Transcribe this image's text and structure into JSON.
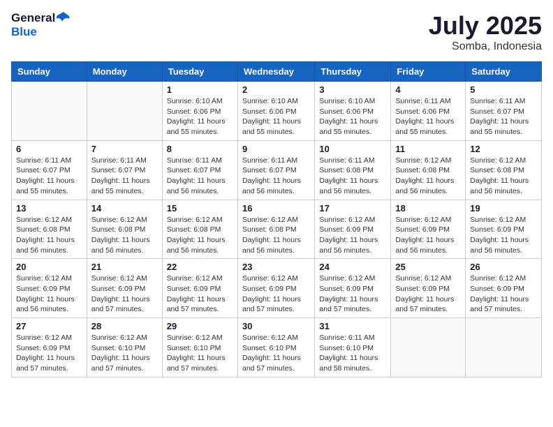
{
  "header": {
    "logo_general": "General",
    "logo_blue": "Blue",
    "title": "July 2025",
    "location": "Somba, Indonesia"
  },
  "calendar": {
    "days_of_week": [
      "Sunday",
      "Monday",
      "Tuesday",
      "Wednesday",
      "Thursday",
      "Friday",
      "Saturday"
    ],
    "weeks": [
      [
        {
          "day": "",
          "info": ""
        },
        {
          "day": "",
          "info": ""
        },
        {
          "day": "1",
          "info": "Sunrise: 6:10 AM\nSunset: 6:06 PM\nDaylight: 11 hours and 55 minutes."
        },
        {
          "day": "2",
          "info": "Sunrise: 6:10 AM\nSunset: 6:06 PM\nDaylight: 11 hours and 55 minutes."
        },
        {
          "day": "3",
          "info": "Sunrise: 6:10 AM\nSunset: 6:06 PM\nDaylight: 11 hours and 55 minutes."
        },
        {
          "day": "4",
          "info": "Sunrise: 6:11 AM\nSunset: 6:06 PM\nDaylight: 11 hours and 55 minutes."
        },
        {
          "day": "5",
          "info": "Sunrise: 6:11 AM\nSunset: 6:07 PM\nDaylight: 11 hours and 55 minutes."
        }
      ],
      [
        {
          "day": "6",
          "info": "Sunrise: 6:11 AM\nSunset: 6:07 PM\nDaylight: 11 hours and 55 minutes."
        },
        {
          "day": "7",
          "info": "Sunrise: 6:11 AM\nSunset: 6:07 PM\nDaylight: 11 hours and 55 minutes."
        },
        {
          "day": "8",
          "info": "Sunrise: 6:11 AM\nSunset: 6:07 PM\nDaylight: 11 hours and 56 minutes."
        },
        {
          "day": "9",
          "info": "Sunrise: 6:11 AM\nSunset: 6:07 PM\nDaylight: 11 hours and 56 minutes."
        },
        {
          "day": "10",
          "info": "Sunrise: 6:11 AM\nSunset: 6:08 PM\nDaylight: 11 hours and 56 minutes."
        },
        {
          "day": "11",
          "info": "Sunrise: 6:12 AM\nSunset: 6:08 PM\nDaylight: 11 hours and 56 minutes."
        },
        {
          "day": "12",
          "info": "Sunrise: 6:12 AM\nSunset: 6:08 PM\nDaylight: 11 hours and 56 minutes."
        }
      ],
      [
        {
          "day": "13",
          "info": "Sunrise: 6:12 AM\nSunset: 6:08 PM\nDaylight: 11 hours and 56 minutes."
        },
        {
          "day": "14",
          "info": "Sunrise: 6:12 AM\nSunset: 6:08 PM\nDaylight: 11 hours and 56 minutes."
        },
        {
          "day": "15",
          "info": "Sunrise: 6:12 AM\nSunset: 6:08 PM\nDaylight: 11 hours and 56 minutes."
        },
        {
          "day": "16",
          "info": "Sunrise: 6:12 AM\nSunset: 6:08 PM\nDaylight: 11 hours and 56 minutes."
        },
        {
          "day": "17",
          "info": "Sunrise: 6:12 AM\nSunset: 6:09 PM\nDaylight: 11 hours and 56 minutes."
        },
        {
          "day": "18",
          "info": "Sunrise: 6:12 AM\nSunset: 6:09 PM\nDaylight: 11 hours and 56 minutes."
        },
        {
          "day": "19",
          "info": "Sunrise: 6:12 AM\nSunset: 6:09 PM\nDaylight: 11 hours and 56 minutes."
        }
      ],
      [
        {
          "day": "20",
          "info": "Sunrise: 6:12 AM\nSunset: 6:09 PM\nDaylight: 11 hours and 56 minutes."
        },
        {
          "day": "21",
          "info": "Sunrise: 6:12 AM\nSunset: 6:09 PM\nDaylight: 11 hours and 57 minutes."
        },
        {
          "day": "22",
          "info": "Sunrise: 6:12 AM\nSunset: 6:09 PM\nDaylight: 11 hours and 57 minutes."
        },
        {
          "day": "23",
          "info": "Sunrise: 6:12 AM\nSunset: 6:09 PM\nDaylight: 11 hours and 57 minutes."
        },
        {
          "day": "24",
          "info": "Sunrise: 6:12 AM\nSunset: 6:09 PM\nDaylight: 11 hours and 57 minutes."
        },
        {
          "day": "25",
          "info": "Sunrise: 6:12 AM\nSunset: 6:09 PM\nDaylight: 11 hours and 57 minutes."
        },
        {
          "day": "26",
          "info": "Sunrise: 6:12 AM\nSunset: 6:09 PM\nDaylight: 11 hours and 57 minutes."
        }
      ],
      [
        {
          "day": "27",
          "info": "Sunrise: 6:12 AM\nSunset: 6:09 PM\nDaylight: 11 hours and 57 minutes."
        },
        {
          "day": "28",
          "info": "Sunrise: 6:12 AM\nSunset: 6:10 PM\nDaylight: 11 hours and 57 minutes."
        },
        {
          "day": "29",
          "info": "Sunrise: 6:12 AM\nSunset: 6:10 PM\nDaylight: 11 hours and 57 minutes."
        },
        {
          "day": "30",
          "info": "Sunrise: 6:12 AM\nSunset: 6:10 PM\nDaylight: 11 hours and 57 minutes."
        },
        {
          "day": "31",
          "info": "Sunrise: 6:11 AM\nSunset: 6:10 PM\nDaylight: 11 hours and 58 minutes."
        },
        {
          "day": "",
          "info": ""
        },
        {
          "day": "",
          "info": ""
        }
      ]
    ]
  }
}
